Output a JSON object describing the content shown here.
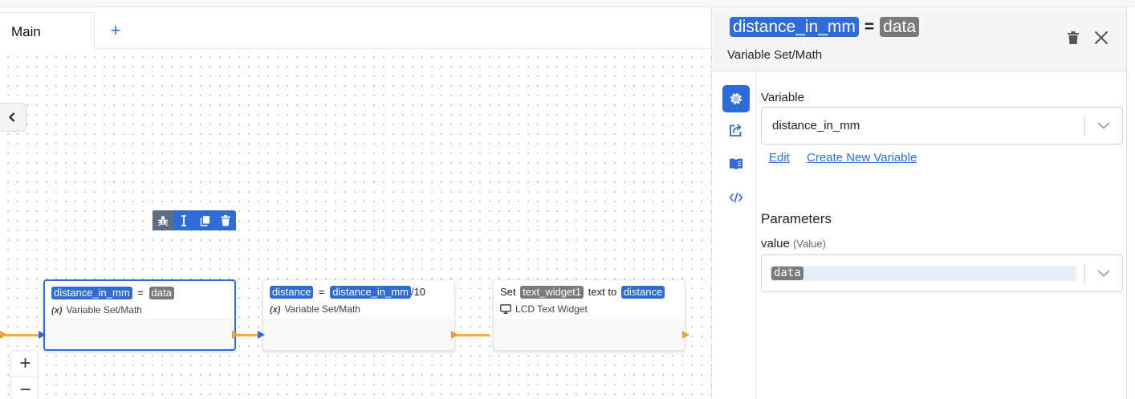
{
  "tabs": {
    "main_label": "Main",
    "add_label": "+"
  },
  "canvas": {
    "zoom_in_label": "+",
    "zoom_out_label": "−"
  },
  "nodes": [
    {
      "lhs": "distance_in_mm",
      "op": "=",
      "rhs": "data",
      "type_icon": "(x)",
      "type_label": "Variable Set/Math"
    },
    {
      "lhs": "distance",
      "op": "=",
      "rhs": "distance_in_mm",
      "suffix": "/10",
      "type_icon": "(x)",
      "type_label": "Variable Set/Math"
    },
    {
      "prefix": "Set",
      "widget": "text_widget1",
      "middle": "text to",
      "value": "distance",
      "type_label": "LCD Text Widget"
    }
  ],
  "node_toolbar": {
    "icons": [
      "bug-icon",
      "text-cursor-icon",
      "copy-icon",
      "trash-icon"
    ]
  },
  "panel": {
    "title_lhs": "distance_in_mm",
    "title_op": "=",
    "title_rhs": "data",
    "subtitle": "Variable Set/Math",
    "rail_icons": [
      "gear-icon",
      "share-icon",
      "book-icon",
      "code-icon"
    ],
    "variable_label": "Variable",
    "variable_value": "distance_in_mm",
    "edit_link": "Edit",
    "create_link": "Create New Variable",
    "parameters_heading": "Parameters",
    "value_label": "value",
    "value_hint": "(Value)",
    "value_token": "data"
  },
  "colors": {
    "accent": "#2f6bd9",
    "wire": "#f0b23d",
    "token_gray": "#7a7a7a"
  }
}
